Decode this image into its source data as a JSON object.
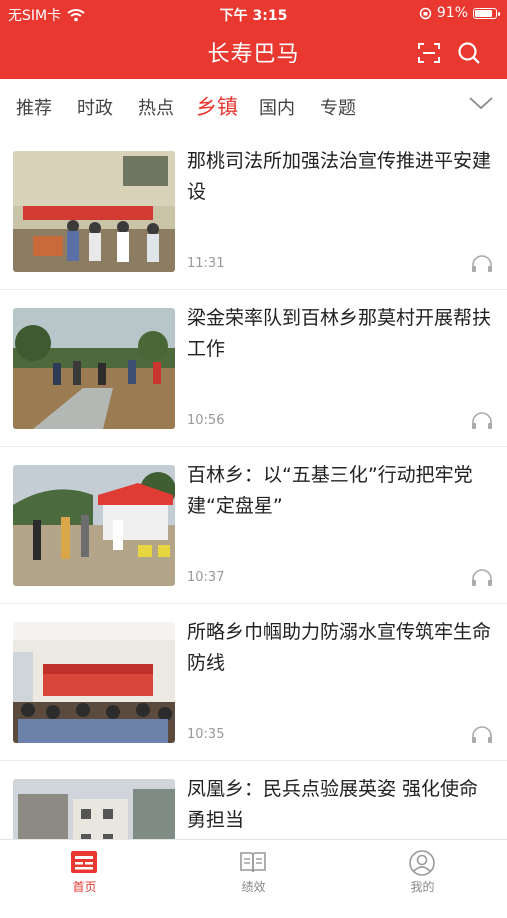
{
  "status_bar": {
    "carrier": "无SIM卡",
    "time": "下午 3:15",
    "battery": "91%",
    "battery_level": 0.91
  },
  "header": {
    "title": "长寿巴马",
    "scan_icon": "scan-icon",
    "search_icon": "search-icon"
  },
  "tabs": [
    {
      "label": "推荐"
    },
    {
      "label": "时政"
    },
    {
      "label": "热点"
    },
    {
      "label": "乡镇",
      "active": true
    },
    {
      "label": "国内"
    },
    {
      "label": "专题"
    }
  ],
  "news": [
    {
      "title": "那桃司法所加强法治宣传推进平安建设",
      "time": "11:31"
    },
    {
      "title": "梁金荣率队到百林乡那莫村开展帮扶工作",
      "time": "10:56"
    },
    {
      "title": "百林乡：以“五基三化”行动把牢党建“定盘星”",
      "time": "10:37"
    },
    {
      "title": "所略乡巾帼助力防溺水宣传筑牢生命防线",
      "time": "10:35"
    },
    {
      "title": "凤凰乡：民兵点验展英姿 强化使命勇担当",
      "time": ""
    }
  ],
  "bottom_nav": [
    {
      "label": "首页",
      "active": true,
      "icon": "home-icon"
    },
    {
      "label": "绩效",
      "icon": "book-icon"
    },
    {
      "label": "我的",
      "icon": "user-icon"
    }
  ],
  "colors": {
    "brand": "#e8382f",
    "text": "#222222",
    "muted": "#999999"
  }
}
